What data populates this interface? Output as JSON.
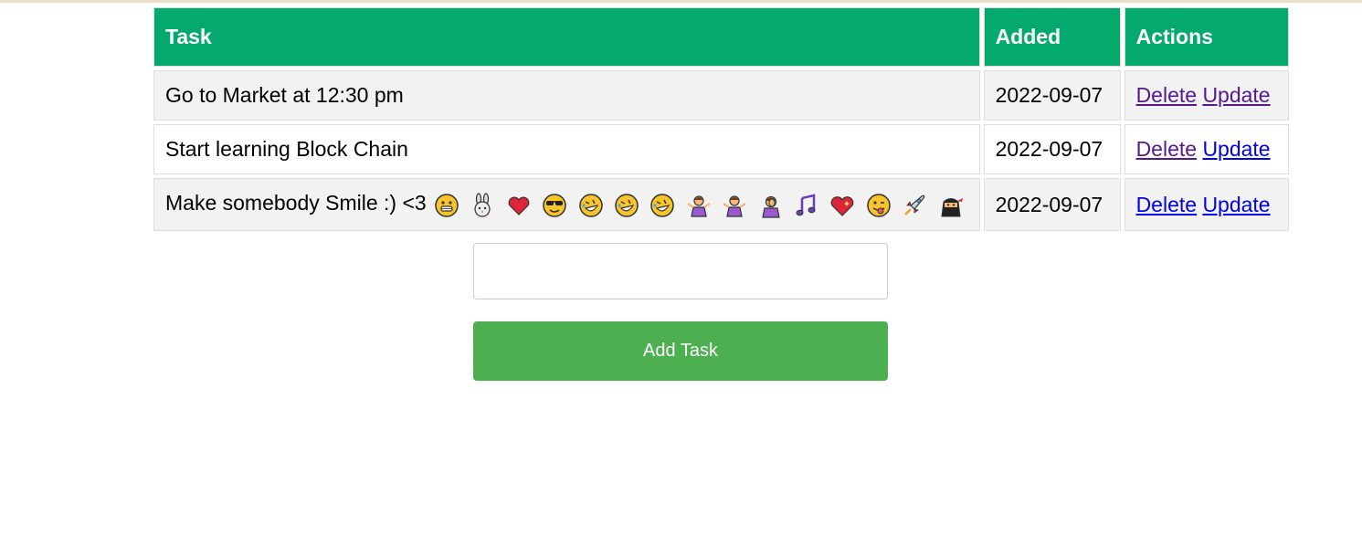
{
  "table": {
    "headers": {
      "task": "Task",
      "added": "Added",
      "actions": "Actions"
    },
    "rows": [
      {
        "task": "Go to Market at 12:30 pm",
        "added": "2022-09-07",
        "delete_label": "Delete",
        "update_label": "Update",
        "emojis": []
      },
      {
        "task": "Start learning Block Chain",
        "added": "2022-09-07",
        "delete_label": "Delete",
        "update_label": "Update",
        "emojis": []
      },
      {
        "task": "Make somebody Smile :) <3",
        "added": "2022-09-07",
        "delete_label": "Delete",
        "update_label": "Update",
        "emojis": [
          "grinning-face",
          "rabbit",
          "red-heart",
          "sunglasses-face",
          "rolling-laughing-face",
          "rolling-laughing-face",
          "rolling-laughing-face",
          "woman-shrugging",
          "woman-shrugging",
          "woman-facepalming",
          "musical-notes",
          "sparkling-heart",
          "winking-tongue-face",
          "rocket",
          "ninja"
        ]
      }
    ]
  },
  "form": {
    "input_value": "",
    "button_label": "Add Task"
  },
  "colors": {
    "header_bg": "#04aa6d",
    "button_bg": "#4caf50",
    "row_alt_bg": "#f2f2f2",
    "visited_link": "#551a8b",
    "link": "#0000ee"
  }
}
